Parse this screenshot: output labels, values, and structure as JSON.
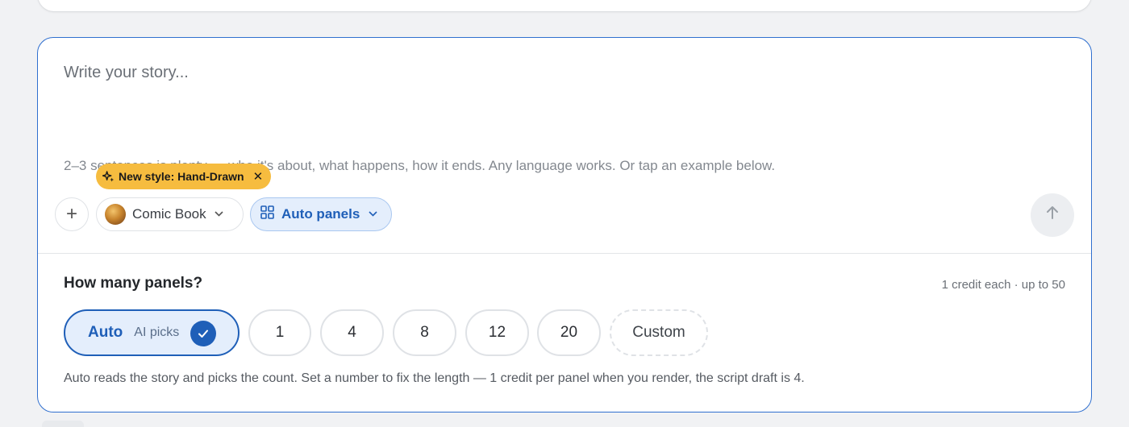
{
  "composer": {
    "placeholder": "Write your story...",
    "hint": "2–3 sentences is plenty — who it's about, what happens, how it ends. Any language works. Or tap an example below."
  },
  "promo": {
    "label": "New style: Hand-Drawn",
    "close": "✕"
  },
  "toolbar": {
    "add_label": "+",
    "style_label": "Comic Book",
    "panels_label": "Auto panels"
  },
  "panels": {
    "title": "How many panels?",
    "meta": "1 credit each · up to 50",
    "auto_label": "Auto",
    "auto_sub": "AI picks",
    "options": [
      "1",
      "4",
      "8",
      "12",
      "20"
    ],
    "custom_label": "Custom",
    "selected": "Auto",
    "description": "Auto reads the story and picks the count. Set a number to fix the length — 1 credit per panel when you render, the script draft is 4."
  },
  "colors": {
    "accent": "#1f5fb8",
    "border_focus": "#2f6fcf",
    "promo_bg": "#f6bc3f"
  },
  "icons": {
    "promo": "sparkle-icon",
    "add": "plus-icon",
    "style": "comic-thumbnail",
    "panels": "grid-icon",
    "chevron": "chevron-down-icon",
    "send": "arrow-up-icon",
    "check": "check-icon"
  }
}
